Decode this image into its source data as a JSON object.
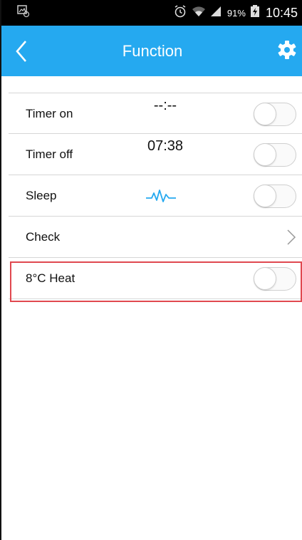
{
  "status_bar": {
    "battery_percent": "91%",
    "time": "10:45",
    "icons": [
      "screenshot-icon",
      "alarm-icon",
      "wifi-icon",
      "signal-icon",
      "battery-charging-icon"
    ]
  },
  "header": {
    "title": "Function",
    "background_color": "#25a9f0",
    "back_icon": "chevron-left-icon",
    "settings_icon": "gear-icon"
  },
  "rows": [
    {
      "label": "Timer on",
      "value": "--:--",
      "control": "toggle",
      "on": false
    },
    {
      "label": "Timer off",
      "value": "07:38",
      "control": "toggle",
      "on": false
    },
    {
      "label": "Sleep",
      "value_icon": "sleep-curve-icon",
      "control": "toggle",
      "on": false
    },
    {
      "label": "Check",
      "control": "chevron-right-icon"
    },
    {
      "label": "8°C Heat",
      "control": "toggle",
      "on": false,
      "highlighted": true
    }
  ],
  "highlight_color": "#e0484f"
}
